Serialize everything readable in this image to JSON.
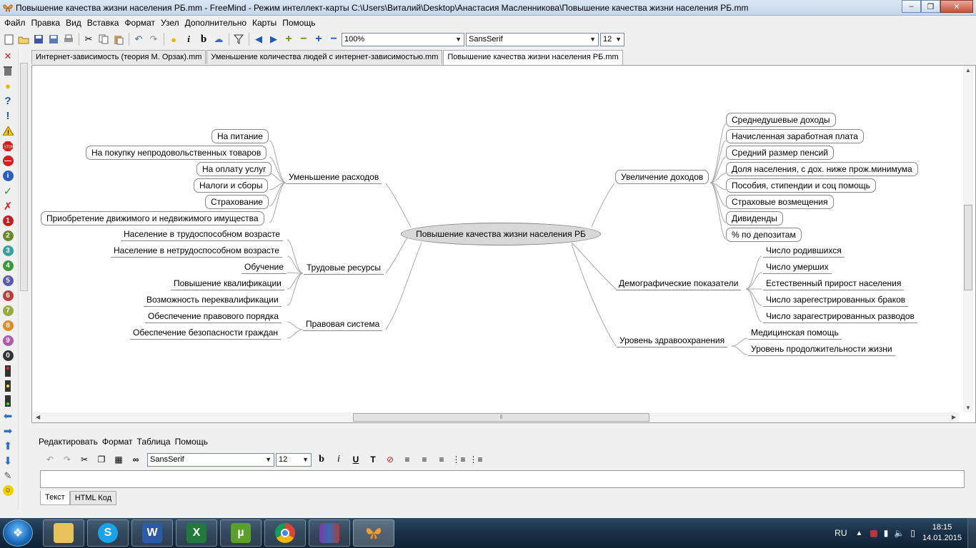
{
  "window": {
    "title": "Повышение качества жизни населения РБ.mm - FreeMind - Режим интеллект-карты C:\\Users\\Виталий\\Desktop\\Анастасия Масленникова\\Повышение качества жизни населения РБ.mm"
  },
  "menu": [
    "Файл",
    "Правка",
    "Вид",
    "Вставка",
    "Формат",
    "Узел",
    "Дополнительно",
    "Карты",
    "Помощь"
  ],
  "toolbar": {
    "zoom": "100%",
    "font": "SansSerif",
    "size": "12"
  },
  "tabs": [
    {
      "label": "Интернет-зависимость (теория М. Орзак).mm"
    },
    {
      "label": "Уменьшение количества людей с интернет-зависимостью.mm"
    },
    {
      "label": "Повышение качества жизни населения РБ.mm"
    }
  ],
  "mindmap": {
    "root": "Повышение качества жизни населения РБ",
    "left": [
      {
        "label": "Уменьшение расходов",
        "children": [
          "На питание",
          "На покупку непродовольственных товаров",
          "На оплату услуг",
          "Налоги и сборы",
          "Страхование",
          "Приобретение движимого и недвижимого имущества"
        ]
      },
      {
        "label": "Трудовые ресурсы",
        "children": [
          "Население в трудоспособном возрасте",
          "Население в нетрудоспособном возрасте",
          "Обучение",
          "Повышение квалификации",
          "Возможность переквалификации"
        ]
      },
      {
        "label": "Правовая система",
        "children": [
          "Обеспечение правового порядка",
          "Обеспечение безопасности граждан"
        ]
      }
    ],
    "right": [
      {
        "label": "Увеличение доходов",
        "children": [
          "Среднедушевые доходы",
          "Начисленная заработная плата",
          "Средний размер пенсий",
          "Доля населения, с дох. ниже прож.минимума",
          "Пособия, стипендии и соц помощь",
          "Страховые возмещения",
          "Дивиденды",
          "% по депозитам"
        ]
      },
      {
        "label": "Демографические показатели",
        "children": [
          "Число родившихся",
          "Число умерших",
          "Естественный прирост населения",
          "Число зарегестрированных браков",
          "Число зарагестрированных разводов"
        ]
      },
      {
        "label": "Уровень здравоохранения",
        "children": [
          "Медицинская помощь",
          "Уровень продолжительности жизни"
        ]
      }
    ]
  },
  "editor": {
    "menu": [
      "Редактировать",
      "Формат",
      "Таблица",
      "Помощь"
    ],
    "font": "SansSerif",
    "size": "12",
    "tabs": [
      "Текст",
      "HTML Код"
    ]
  },
  "taskbar": {
    "apps": [
      "explorer",
      "skype",
      "word",
      "excel",
      "utorrent",
      "chrome",
      "winrar",
      "freemind"
    ],
    "lang": "RU",
    "time": "18:15",
    "date": "14.01.2015"
  },
  "colors": {
    "accent": "#3399ff",
    "root_fill": "#d8d8d8",
    "link": "#999999"
  }
}
